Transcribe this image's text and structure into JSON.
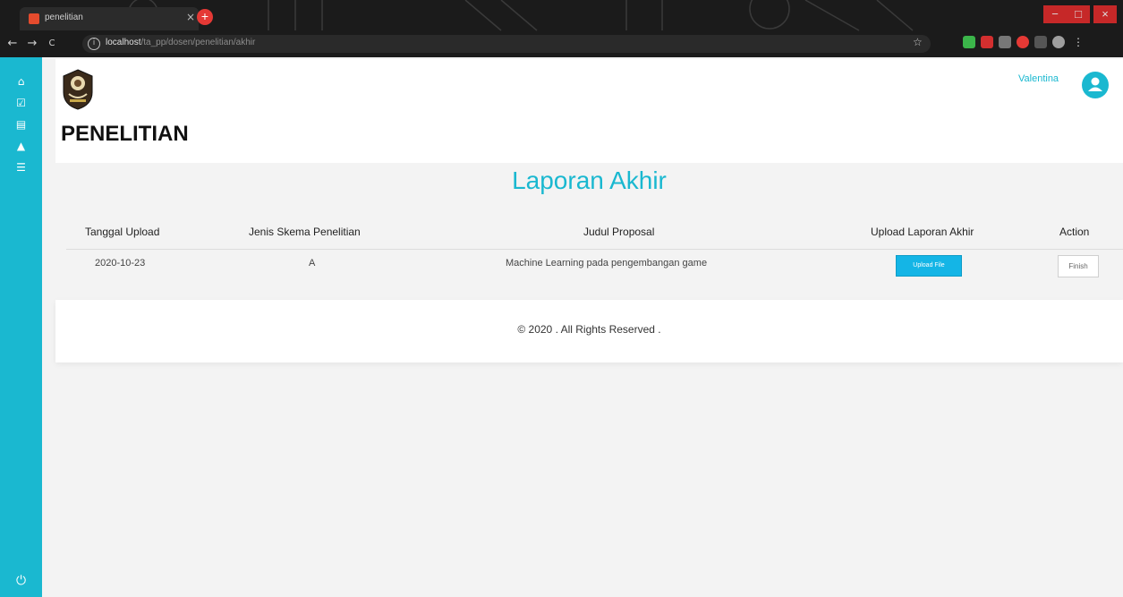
{
  "browser": {
    "tab_title": "penelitian",
    "url_host": "localhost",
    "url_path": "/ta_pp/dosen/penelitian/akhir",
    "new_tab_glyph": "+",
    "tab_close_glyph": "×",
    "window": {
      "minimize": "−",
      "maximize": "□",
      "close": "×"
    },
    "nav": {
      "back": "←",
      "forward": "→",
      "reload": "C"
    }
  },
  "sidebar": {
    "items": [
      {
        "icon": "home-icon",
        "glyph": "⌂"
      },
      {
        "icon": "checkbox-icon",
        "glyph": "☑"
      },
      {
        "icon": "document-icon",
        "glyph": "▤"
      },
      {
        "icon": "warning-icon",
        "glyph": "▲"
      },
      {
        "icon": "list-icon",
        "glyph": "☰"
      }
    ],
    "power": {
      "icon": "power-icon",
      "glyph": "⏻"
    }
  },
  "header": {
    "title": "PENELITIAN",
    "user_name": "Valentina"
  },
  "main": {
    "section_title": "Laporan Akhir",
    "table": {
      "columns": [
        "Tanggal Upload",
        "Jenis Skema Penelitian",
        "Judul Proposal",
        "Upload Laporan Akhir",
        "Action"
      ],
      "rows": [
        {
          "tanggal": "2020-10-23",
          "jenis": "A",
          "judul": "Machine Learning pada pengembangan game",
          "upload_label": "Upload File",
          "action_label": "Finish"
        }
      ]
    }
  },
  "footer": {
    "text": "© 2020 . All Rights Reserved ."
  },
  "colors": {
    "accent": "#1ab8d0",
    "upload_button": "#14b5e6",
    "chrome_bg": "#1b1b1b"
  }
}
